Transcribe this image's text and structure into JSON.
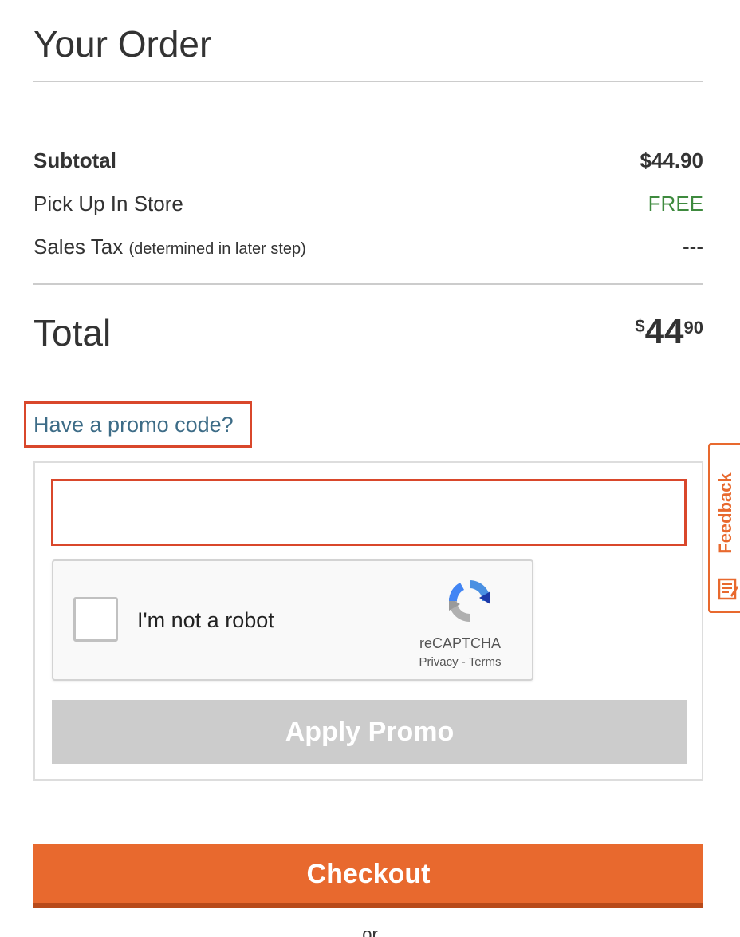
{
  "order": {
    "title": "Your Order",
    "subtotal_label": "Subtotal",
    "subtotal_value": "$44.90",
    "pickup_label": "Pick Up In Store",
    "pickup_value": "FREE",
    "tax_label": "Sales Tax",
    "tax_note": "(determined in later step)",
    "tax_value": "---",
    "total_label": "Total",
    "total_currency": "$",
    "total_dollars": "44",
    "total_cents": "90"
  },
  "promo": {
    "link_label": "Have a promo code?",
    "input_value": "",
    "input_placeholder": "",
    "apply_label": "Apply Promo"
  },
  "captcha": {
    "label": "I'm not a robot",
    "brand": "reCAPTCHA",
    "privacy": "Privacy",
    "separator": " - ",
    "terms": "Terms"
  },
  "checkout": {
    "label": "Checkout",
    "or_text": "or"
  },
  "feedback": {
    "label": "Feedback"
  },
  "colors": {
    "accent": "#e8692e",
    "free": "#3e8a3e",
    "link": "#3d6c87",
    "highlight": "#d9472b",
    "disabled": "#cccccc"
  }
}
